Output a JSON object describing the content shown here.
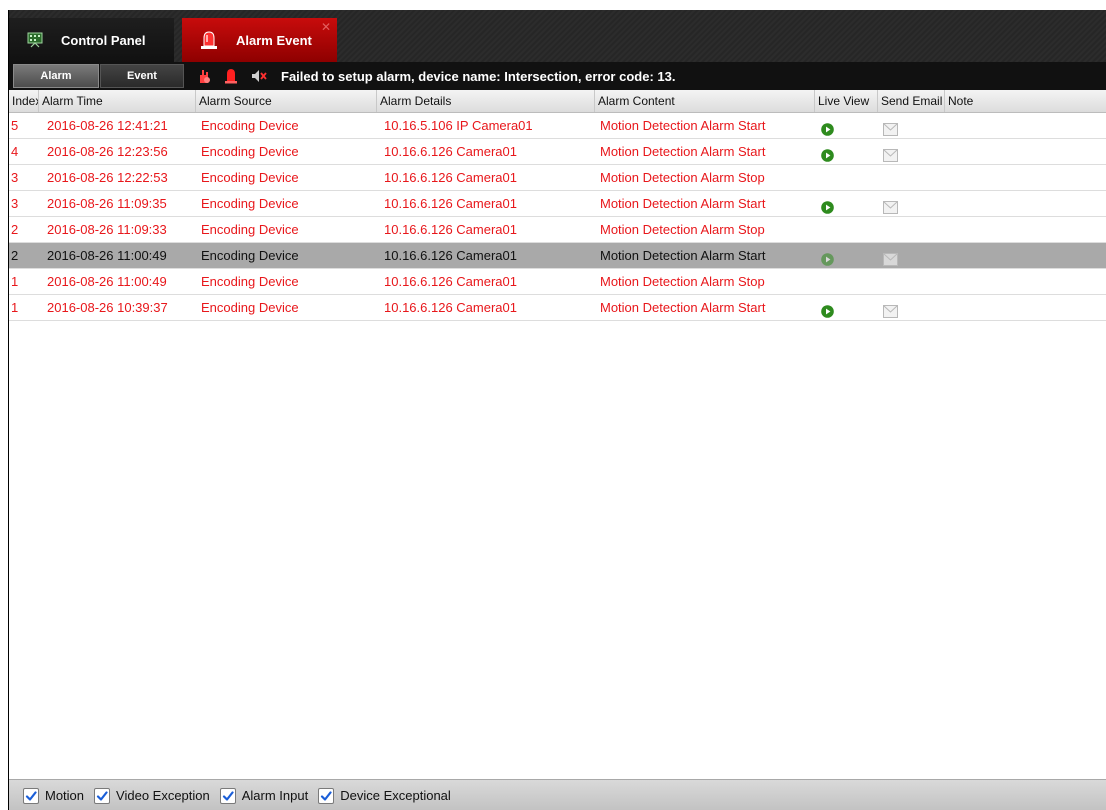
{
  "tabs": {
    "control_panel": {
      "label": "Control Panel",
      "icon": "control-panel-icon"
    },
    "alarm_event": {
      "label": "Alarm Event",
      "icon": "alarm-siren-icon",
      "close": "✕"
    }
  },
  "toolbar": {
    "alarm_label": "Alarm",
    "event_label": "Event",
    "icons": [
      "alarm-hand-icon",
      "alarm-siren-icon",
      "mute-speaker-icon"
    ],
    "status_message": "Failed to setup alarm, device name: Intersection, error code: 13."
  },
  "table": {
    "columns": {
      "index": "Index",
      "time": "Alarm Time",
      "source": "Alarm Source",
      "details": "Alarm Details",
      "content": "Alarm Content",
      "live": "Live View",
      "email": "Send Email",
      "note": "Note"
    },
    "rows": [
      {
        "index": "5",
        "time": "2016-08-26 12:41:21",
        "source": "Encoding Device",
        "details": "10.16.5.106 IP Camera01",
        "content": "Motion Detection Alarm Start",
        "live": true,
        "email": true,
        "selected": false
      },
      {
        "index": "4",
        "time": "2016-08-26 12:23:56",
        "source": "Encoding Device",
        "details": "10.16.6.126 Camera01",
        "content": "Motion Detection Alarm Start",
        "live": true,
        "email": true,
        "selected": false
      },
      {
        "index": "3",
        "time": "2016-08-26 12:22:53",
        "source": "Encoding Device",
        "details": "10.16.6.126 Camera01",
        "content": "Motion Detection Alarm Stop",
        "live": false,
        "email": false,
        "selected": false
      },
      {
        "index": "3",
        "time": "2016-08-26 11:09:35",
        "source": "Encoding Device",
        "details": "10.16.6.126 Camera01",
        "content": "Motion Detection Alarm Start",
        "live": true,
        "email": true,
        "selected": false
      },
      {
        "index": "2",
        "time": "2016-08-26 11:09:33",
        "source": "Encoding Device",
        "details": "10.16.6.126 Camera01",
        "content": "Motion Detection Alarm Stop",
        "live": false,
        "email": false,
        "selected": false
      },
      {
        "index": "2",
        "time": "2016-08-26 11:00:49",
        "source": "Encoding Device",
        "details": "10.16.6.126 Camera01",
        "content": "Motion Detection Alarm Start",
        "live": true,
        "email": true,
        "selected": true
      },
      {
        "index": "1",
        "time": "2016-08-26 11:00:49",
        "source": "Encoding Device",
        "details": "10.16.6.126 Camera01",
        "content": "Motion Detection Alarm Stop",
        "live": false,
        "email": false,
        "selected": false
      },
      {
        "index": "1",
        "time": "2016-08-26 10:39:37",
        "source": "Encoding Device",
        "details": "10.16.6.126 Camera01",
        "content": "Motion Detection Alarm Start",
        "live": true,
        "email": true,
        "selected": false
      }
    ]
  },
  "filters": [
    {
      "label": "Motion",
      "checked": true
    },
    {
      "label": "Video Exception",
      "checked": true
    },
    {
      "label": "Alarm Input",
      "checked": true
    },
    {
      "label": "Device Exceptional",
      "checked": true
    }
  ],
  "colors": {
    "alarm_text": "#e8171b",
    "selected_row": "#a9a9a9",
    "tab_active": "#c80c0c",
    "play_green": "#2e8b1e"
  }
}
